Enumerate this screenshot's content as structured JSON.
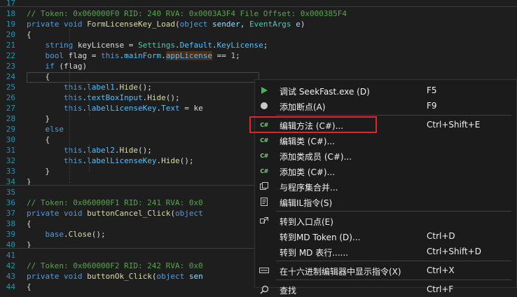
{
  "editor": {
    "lines": [
      {
        "n": "17",
        "t": []
      },
      {
        "n": "18",
        "t": [
          [
            "c-com",
            "// Token: 0x060000F0 RID: 240 RVA: 0x0003A3F4 File Offset: 0x000385F4"
          ]
        ]
      },
      {
        "n": "19",
        "t": [
          [
            "c-kw",
            "private"
          ],
          [
            "c-plain",
            " "
          ],
          [
            "c-kw",
            "void"
          ],
          [
            "c-plain",
            " "
          ],
          [
            "c-meth",
            "FormLicenseKey_Load"
          ],
          [
            "c-plain",
            "("
          ],
          [
            "c-kw",
            "object"
          ],
          [
            "c-plain",
            " "
          ],
          [
            "c-prm",
            "sender"
          ],
          [
            "c-plain",
            ", "
          ],
          [
            "c-type",
            "EventArgs"
          ],
          [
            "c-plain",
            " "
          ],
          [
            "c-prm",
            "e"
          ],
          [
            "c-plain",
            ")"
          ]
        ]
      },
      {
        "n": "20",
        "t": [
          [
            "c-plain",
            "{"
          ]
        ]
      },
      {
        "n": "21",
        "t": [
          [
            "c-plain",
            "    "
          ],
          [
            "c-kw",
            "string"
          ],
          [
            "c-plain",
            " keyLicense = "
          ],
          [
            "c-type",
            "Settings"
          ],
          [
            "c-plain",
            "."
          ],
          [
            "c-fld",
            "Default"
          ],
          [
            "c-plain",
            "."
          ],
          [
            "c-fld",
            "KeyLicense"
          ],
          [
            "c-plain",
            ";"
          ]
        ]
      },
      {
        "n": "22",
        "t": [
          [
            "c-plain",
            "    "
          ],
          [
            "c-kw",
            "bool"
          ],
          [
            "c-plain",
            " flag = "
          ],
          [
            "c-kw",
            "this"
          ],
          [
            "c-plain",
            "."
          ],
          [
            "c-fld",
            "mainForm"
          ],
          [
            "c-plain",
            "."
          ],
          [
            "c-fld c-hl",
            "appLicense"
          ],
          [
            "c-plain",
            " == "
          ],
          [
            "c-num",
            "1"
          ],
          [
            "c-plain",
            ";"
          ]
        ]
      },
      {
        "n": "23",
        "t": [
          [
            "c-plain",
            "    "
          ],
          [
            "c-kw",
            "if"
          ],
          [
            "c-plain",
            " (flag)"
          ]
        ]
      },
      {
        "n": "24",
        "t": [
          [
            "c-plain",
            "    {"
          ]
        ]
      },
      {
        "n": "25",
        "t": [
          [
            "c-plain",
            "        "
          ],
          [
            "c-kw",
            "this"
          ],
          [
            "c-plain",
            "."
          ],
          [
            "c-fld",
            "label1"
          ],
          [
            "c-plain",
            "."
          ],
          [
            "c-meth",
            "Hide"
          ],
          [
            "c-plain",
            "();"
          ]
        ]
      },
      {
        "n": "26",
        "t": [
          [
            "c-plain",
            "        "
          ],
          [
            "c-kw",
            "this"
          ],
          [
            "c-plain",
            "."
          ],
          [
            "c-fld",
            "textBoxInput"
          ],
          [
            "c-plain",
            "."
          ],
          [
            "c-meth",
            "Hide"
          ],
          [
            "c-plain",
            "();"
          ]
        ]
      },
      {
        "n": "27",
        "t": [
          [
            "c-plain",
            "        "
          ],
          [
            "c-kw",
            "this"
          ],
          [
            "c-plain",
            "."
          ],
          [
            "c-fld",
            "labelLicenseKey"
          ],
          [
            "c-plain",
            "."
          ],
          [
            "c-fld",
            "Text"
          ],
          [
            "c-plain",
            " = ke"
          ]
        ]
      },
      {
        "n": "28",
        "t": [
          [
            "c-plain",
            "    }"
          ]
        ]
      },
      {
        "n": "29",
        "t": [
          [
            "c-plain",
            "    "
          ],
          [
            "c-kw",
            "else"
          ]
        ]
      },
      {
        "n": "30",
        "t": [
          [
            "c-plain",
            "    {"
          ]
        ]
      },
      {
        "n": "31",
        "t": [
          [
            "c-plain",
            "        "
          ],
          [
            "c-kw",
            "this"
          ],
          [
            "c-plain",
            "."
          ],
          [
            "c-fld",
            "label2"
          ],
          [
            "c-plain",
            "."
          ],
          [
            "c-meth",
            "Hide"
          ],
          [
            "c-plain",
            "();"
          ]
        ]
      },
      {
        "n": "32",
        "t": [
          [
            "c-plain",
            "        "
          ],
          [
            "c-kw",
            "this"
          ],
          [
            "c-plain",
            "."
          ],
          [
            "c-fld",
            "labelLicenseKey"
          ],
          [
            "c-plain",
            "."
          ],
          [
            "c-meth",
            "Hide"
          ],
          [
            "c-plain",
            "();"
          ]
        ]
      },
      {
        "n": "33",
        "t": [
          [
            "c-plain",
            "    }"
          ]
        ]
      },
      {
        "n": "34",
        "t": [
          [
            "c-plain",
            "}"
          ]
        ]
      },
      {
        "n": "35",
        "t": []
      },
      {
        "n": "36",
        "t": [
          [
            "c-com",
            "// Token: 0x060000F1 RID: 241 RVA: 0x0"
          ]
        ]
      },
      {
        "n": "37",
        "t": [
          [
            "c-kw",
            "private"
          ],
          [
            "c-plain",
            " "
          ],
          [
            "c-kw",
            "void"
          ],
          [
            "c-plain",
            " "
          ],
          [
            "c-meth",
            "buttonCancel_Click"
          ],
          [
            "c-plain",
            "("
          ],
          [
            "c-kw",
            "object"
          ]
        ]
      },
      {
        "n": "38",
        "t": [
          [
            "c-plain",
            "{"
          ]
        ]
      },
      {
        "n": "39",
        "t": [
          [
            "c-plain",
            "    "
          ],
          [
            "c-kw",
            "base"
          ],
          [
            "c-plain",
            "."
          ],
          [
            "c-meth",
            "Close"
          ],
          [
            "c-plain",
            "();"
          ]
        ]
      },
      {
        "n": "40",
        "t": [
          [
            "c-plain",
            "}"
          ]
        ]
      },
      {
        "n": "41",
        "t": []
      },
      {
        "n": "42",
        "t": [
          [
            "c-com",
            "// Token: 0x060000F2 RID: 242 RVA: 0x0"
          ]
        ]
      },
      {
        "n": "43",
        "t": [
          [
            "c-kw",
            "private"
          ],
          [
            "c-plain",
            " "
          ],
          [
            "c-kw",
            "void"
          ],
          [
            "c-plain",
            " "
          ],
          [
            "c-meth",
            "buttonOk_Click"
          ],
          [
            "c-plain",
            "("
          ],
          [
            "c-kw",
            "object"
          ],
          [
            "c-plain",
            " "
          ],
          [
            "c-prm",
            "sen"
          ]
        ]
      },
      {
        "n": "44",
        "t": [
          [
            "c-plain",
            "{"
          ]
        ]
      }
    ]
  },
  "context_menu": {
    "items": [
      {
        "id": "debug",
        "icon": "play-icon",
        "label": "调试 SeekFast.exe (D)",
        "shortcut": "F5"
      },
      {
        "id": "breakpoint",
        "icon": "breakpoint-icon",
        "label": "添加断点(A)",
        "shortcut": "F9"
      },
      {
        "id": "sep1",
        "separator": true
      },
      {
        "id": "edit-method",
        "icon": "csharp-icon",
        "label": "编辑方法 (C#)...",
        "shortcut": "Ctrl+Shift+E",
        "highlighted": true
      },
      {
        "id": "edit-class",
        "icon": "csharp-icon",
        "label": "编辑类 (C#)...",
        "shortcut": ""
      },
      {
        "id": "add-member",
        "icon": "csharp-icon",
        "label": "添加类成员 (C#)...",
        "shortcut": ""
      },
      {
        "id": "add-class",
        "icon": "csharp-icon",
        "label": "添加类 (C#)...",
        "shortcut": ""
      },
      {
        "id": "merge-assembly",
        "icon": "merge-icon",
        "label": "与程序集合并...",
        "shortcut": ""
      },
      {
        "id": "edit-il",
        "icon": "il-icon",
        "label": "编辑IL指令(S)",
        "shortcut": ""
      },
      {
        "id": "sep2",
        "separator": true
      },
      {
        "id": "goto-entry",
        "icon": "entrypoint-icon",
        "label": "转到入口点(E)",
        "shortcut": ""
      },
      {
        "id": "goto-token",
        "icon": "",
        "label": "转到MD Token (D)...",
        "shortcut": "Ctrl+D"
      },
      {
        "id": "goto-table",
        "icon": "",
        "label": "转到 MD 表行......",
        "shortcut": "Ctrl+Shift+D"
      },
      {
        "id": "sep3",
        "separator": true
      },
      {
        "id": "hex-editor",
        "icon": "hex-icon",
        "label": "在十六进制编辑器中显示指令(X)",
        "shortcut": "Ctrl+X"
      },
      {
        "id": "sep4",
        "separator": true
      },
      {
        "id": "find",
        "icon": "search-icon",
        "label": "查找",
        "shortcut": "Ctrl+F"
      }
    ]
  }
}
